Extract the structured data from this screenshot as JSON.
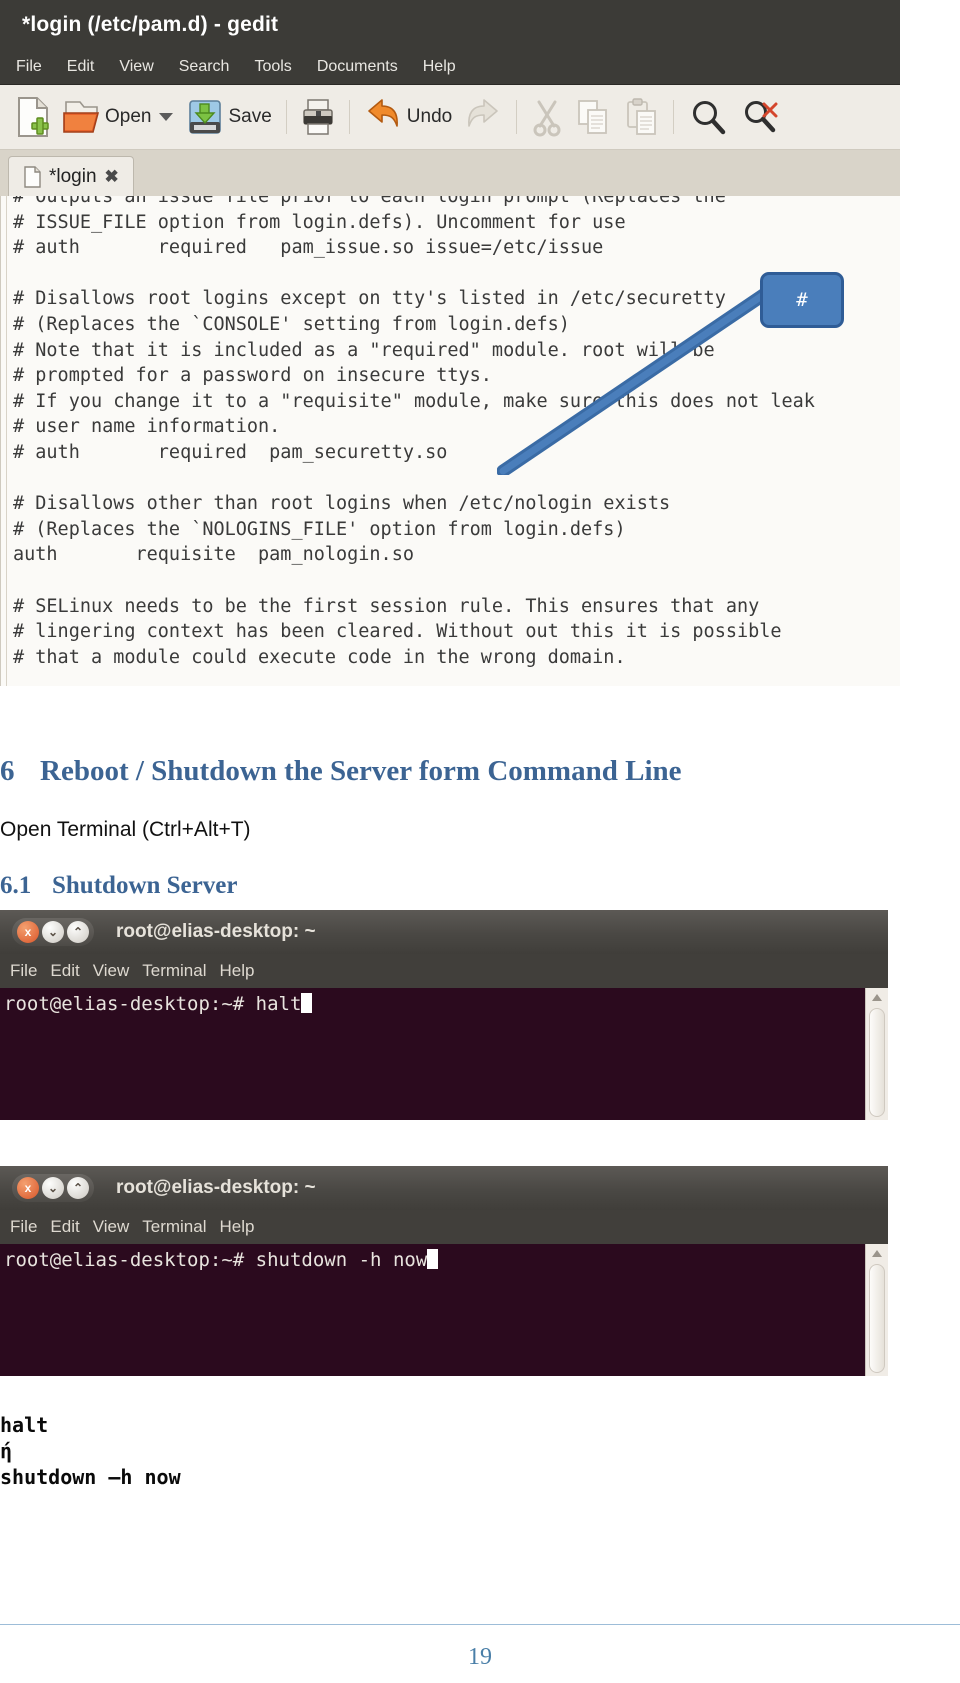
{
  "gedit": {
    "title": "*login (/etc/pam.d) - gedit",
    "menu": [
      "File",
      "Edit",
      "View",
      "Search",
      "Tools",
      "Documents",
      "Help"
    ],
    "toolbar": {
      "new_label": "",
      "open_label": "Open",
      "save_label": "Save",
      "print_label": "",
      "undo_label": "Undo",
      "redo_label": "",
      "cut_label": "",
      "copy_label": "",
      "paste_label": "",
      "find_label": "",
      "replace_label": ""
    },
    "tab": {
      "label": "*login",
      "close": "✖"
    },
    "editor_lines": [
      "# Outputs an issue file prior to each login prompt (Replaces the",
      "# ISSUE_FILE option from login.defs). Uncomment for use",
      "# auth       required   pam_issue.so issue=/etc/issue",
      "",
      "# Disallows root logins except on tty's listed in /etc/securetty",
      "# (Replaces the `CONSOLE' setting from login.defs)",
      "# Note that it is included as a \"required\" module. root will be",
      "# prompted for a password on insecure ttys.",
      "# If you change it to a \"requisite\" module, make sure this does not leak",
      "# user name information.",
      "# auth       required  pam_securetty.so",
      "",
      "# Disallows other than root logins when /etc/nologin exists",
      "# (Replaces the `NOLOGINS_FILE' option from login.defs)",
      "auth       requisite  pam_nologin.so",
      "",
      "# SELinux needs to be the first session rule. This ensures that any",
      "# lingering context has been cleared. Without out this it is possible",
      "# that a module could execute code in the wrong domain."
    ],
    "callout": {
      "text": "#"
    }
  },
  "document": {
    "heading1": {
      "number": "6",
      "text": "Reboot / Shutdown the Server form Command Line"
    },
    "paragraph": "Open Terminal (Ctrl+Alt+T)",
    "heading2": {
      "number": "6.1",
      "text": "Shutdown Server"
    },
    "code_block": "halt\nή\nshutdown –h now",
    "page_number": "19"
  },
  "terminal1": {
    "title": "root@elias-desktop: ~",
    "menu": [
      "File",
      "Edit",
      "View",
      "Terminal",
      "Help"
    ],
    "prompt": "root@elias-desktop:~# ",
    "command": "halt",
    "buttons": {
      "close": "x",
      "minimize": "⌄",
      "maximize": "⌃"
    }
  },
  "terminal2": {
    "title": "root@elias-desktop: ~",
    "menu": [
      "File",
      "Edit",
      "View",
      "Terminal",
      "Help"
    ],
    "prompt": "root@elias-desktop:~# ",
    "command": "shutdown -h now",
    "buttons": {
      "close": "x",
      "minimize": "⌄",
      "maximize": "⌃"
    }
  },
  "colors": {
    "heading": "#3c6493",
    "titlebar": "#3c3b37",
    "terminal_bg": "#2b0a1e",
    "callout": "#4a7ebb",
    "footer": "#4a7fa8"
  }
}
